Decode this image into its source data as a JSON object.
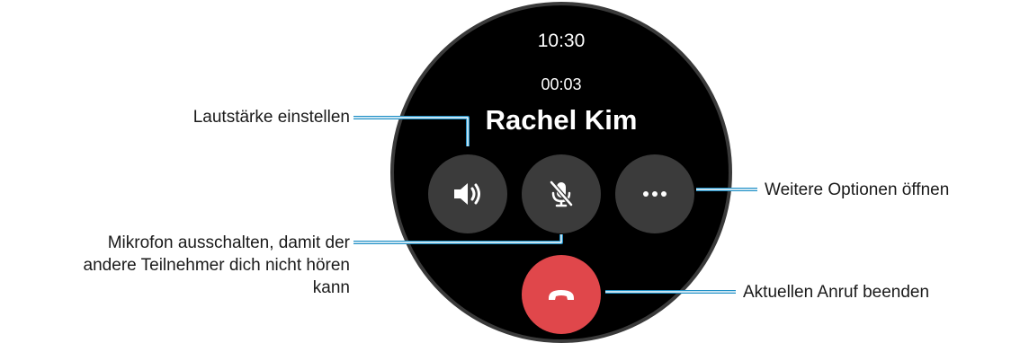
{
  "watch": {
    "time": "10:30",
    "call_duration": "00:03",
    "caller_name": "Rachel Kim",
    "buttons": {
      "volume": "volume-icon",
      "mute": "mic-off-icon",
      "more": "more-options-icon",
      "end_call": "end-call-icon"
    }
  },
  "callouts": {
    "volume": "Lautstärke einstellen",
    "more_options": "Weitere Optionen öffnen",
    "mute_line1": "Mikrofon ausschalten, damit der",
    "mute_line2": "andere Teilnehmer dich nicht hören",
    "mute_line3": "kann",
    "end_call": "Aktuellen Anruf beenden"
  },
  "colors": {
    "watch_background": "#000000",
    "button_background": "#3b3b3b",
    "end_call_red": "#e0474b",
    "callout_line_blue": "#1e8fc6",
    "text": "#1a1a1a"
  }
}
